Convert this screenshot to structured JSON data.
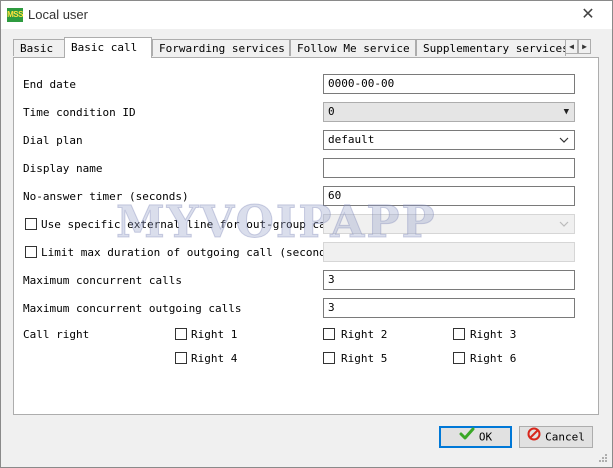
{
  "window": {
    "app_icon_text": "MSS",
    "title": "Local user",
    "close_glyph": "✕"
  },
  "tabs": [
    {
      "label": "Basic",
      "active": false
    },
    {
      "label": "Basic call",
      "active": true
    },
    {
      "label": "Forwarding services",
      "active": false
    },
    {
      "label": "Follow Me service",
      "active": false
    },
    {
      "label": "Supplementary services",
      "active": false
    }
  ],
  "tab_scroll": {
    "left": "◀",
    "right": "▶"
  },
  "form": {
    "end_date": {
      "label": "End date",
      "value": "0000-00-00"
    },
    "time_condition": {
      "label": "Time condition ID",
      "value": "0"
    },
    "dial_plan": {
      "label": "Dial plan",
      "value": "default"
    },
    "display_name": {
      "label": "Display name",
      "value": ""
    },
    "no_answer_timer": {
      "label": "No-answer timer (seconds)",
      "value": "60"
    },
    "external_line": {
      "label": "Use specific external line for out-group call",
      "checked": false,
      "value": ""
    },
    "limit_duration": {
      "label": "Limit max duration of outgoing call (seconds)",
      "checked": false,
      "value": ""
    },
    "max_concurrent": {
      "label": "Maximum concurrent calls",
      "value": "3"
    },
    "max_outgoing": {
      "label": "Maximum concurrent outgoing calls",
      "value": "3"
    },
    "call_right": {
      "label": "Call right",
      "rights": [
        {
          "label": "Right 1",
          "checked": false
        },
        {
          "label": "Right 2",
          "checked": false
        },
        {
          "label": "Right 3",
          "checked": false
        },
        {
          "label": "Right 4",
          "checked": false
        },
        {
          "label": "Right 5",
          "checked": false
        },
        {
          "label": "Right 6",
          "checked": false
        }
      ]
    }
  },
  "watermark": "MYVOIPAPP",
  "buttons": {
    "ok": "OK",
    "cancel": "Cancel"
  },
  "colors": {
    "ok_icon": "#3aa827",
    "cancel_icon": "#d8271c",
    "focus_border": "#0078d7"
  }
}
